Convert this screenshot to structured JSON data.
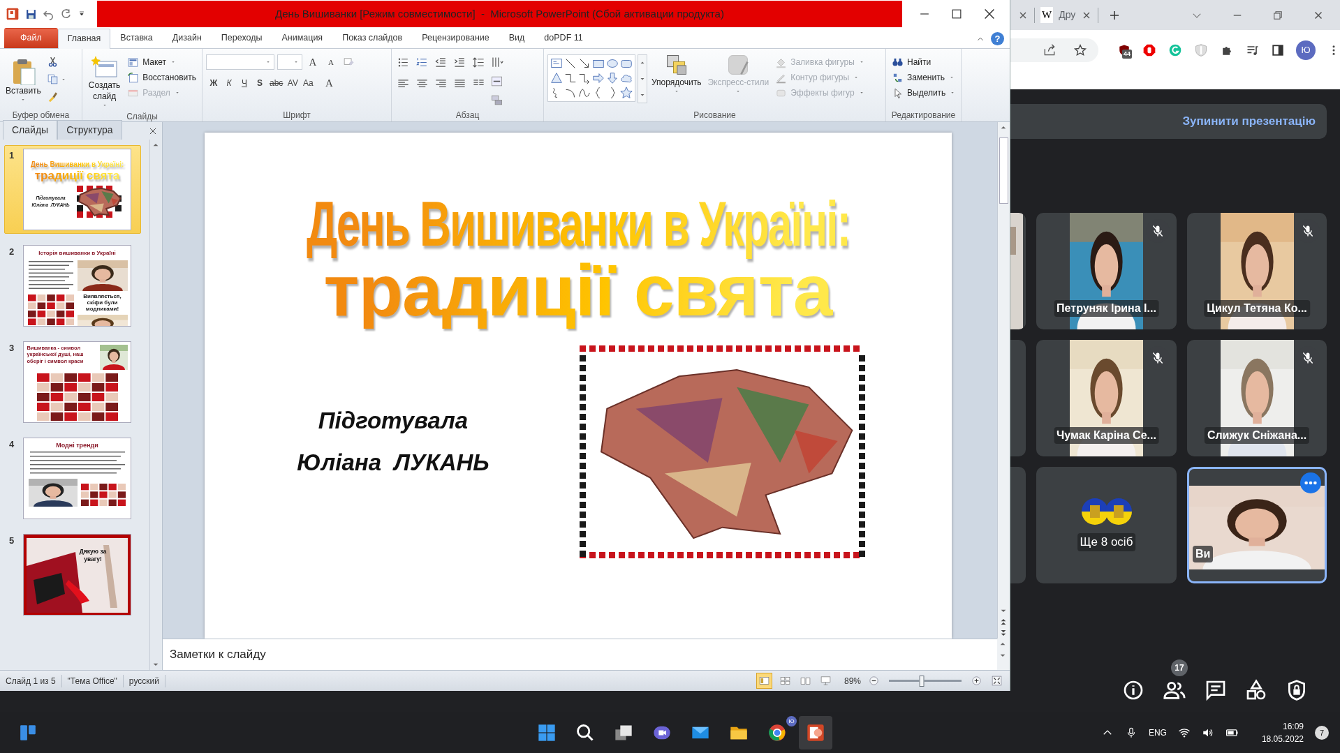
{
  "ppt": {
    "title": "День Вишиванки [Режим совместимости]  -  Microsoft PowerPoint (Сбой активации продукта)",
    "tabs": [
      {
        "label": "Файл",
        "kind": "file",
        "selected": false
      },
      {
        "label": "Главная",
        "kind": "tab",
        "selected": true
      },
      {
        "label": "Вставка",
        "kind": "tab",
        "selected": false
      },
      {
        "label": "Дизайн",
        "kind": "tab",
        "selected": false
      },
      {
        "label": "Переходы",
        "kind": "tab",
        "selected": false
      },
      {
        "label": "Анимация",
        "kind": "tab",
        "selected": false
      },
      {
        "label": "Показ слайдов",
        "kind": "tab",
        "selected": false
      },
      {
        "label": "Рецензирование",
        "kind": "tab",
        "selected": false
      },
      {
        "label": "Вид",
        "kind": "tab",
        "selected": false
      },
      {
        "label": "doPDF 11",
        "kind": "tab",
        "selected": false
      }
    ],
    "help": "?",
    "ribbon": [
      {
        "label": "Буфер обмена",
        "kind": "clipboard",
        "items": [
          {
            "label": "Вставить",
            "kind": "large",
            "disabled": false
          }
        ]
      },
      {
        "label": "Слайды",
        "kind": "slides",
        "items": [
          {
            "label": "Создать слайд",
            "kind": "large",
            "disabled": false
          },
          {
            "label": "Макет",
            "kind": "small",
            "disabled": false
          },
          {
            "label": "Восстановить",
            "kind": "small",
            "disabled": false
          },
          {
            "label": "Раздел",
            "kind": "small",
            "disabled": true
          }
        ]
      },
      {
        "label": "Шрифт",
        "kind": "font",
        "size_buttons": [
          "A",
          "A"
        ],
        "format_buttons": [
          "Ж",
          "К",
          "Ч",
          "S",
          "abc",
          "AV",
          "Aa",
          "A"
        ]
      },
      {
        "label": "Абзац",
        "kind": "paragraph"
      },
      {
        "label": "Рисование",
        "kind": "drawing",
        "items": [
          {
            "label": "Упорядочить",
            "kind": "large",
            "disabled": false
          },
          {
            "label": "Экспресс-стили",
            "kind": "large",
            "disabled": true
          },
          {
            "label": "Заливка фигуры",
            "kind": "small",
            "disabled": true
          },
          {
            "label": "Контур фигуры",
            "kind": "small",
            "disabled": true
          },
          {
            "label": "Эффекты фигур",
            "kind": "small",
            "disabled": true
          }
        ]
      },
      {
        "label": "Редактирование",
        "kind": "editing",
        "items": [
          {
            "label": "Найти",
            "kind": "small",
            "disabled": false
          },
          {
            "label": "Заменить",
            "kind": "small",
            "disabled": false
          },
          {
            "label": "Выделить",
            "kind": "small",
            "disabled": false
          }
        ]
      }
    ],
    "pane_tabs": [
      {
        "label": "Слайды",
        "selected": true
      },
      {
        "label": "Структура",
        "selected": false
      }
    ],
    "slides": [
      {
        "number": "1",
        "selected": true,
        "kind": "title",
        "lines": [
          "День Вишиванки в Україні:",
          "традиції свята",
          "Підготувала",
          "Юліана  ЛУКАНЬ"
        ]
      },
      {
        "number": "2",
        "selected": false,
        "kind": "collage",
        "title": "Історія вишиванки в Україні",
        "caption": "Виявляється, скіфи були модниками!"
      },
      {
        "number": "3",
        "selected": false,
        "kind": "patterns",
        "title": "Вишиванка - символ української душі, наш оберіг і символ краси"
      },
      {
        "number": "4",
        "selected": false,
        "kind": "text",
        "title": "Модні тренди"
      },
      {
        "number": "5",
        "selected": false,
        "kind": "closing",
        "title": "Дякую за увагу!"
      }
    ],
    "slide": {
      "title": "День Вишиванки в Україні:",
      "subtitle": "традиції свята",
      "author_label": "Підготувала",
      "author": "Юліана  ЛУКАНЬ"
    },
    "notes": {
      "placeholder": "Заметки к слайду"
    },
    "status": {
      "slide": "Слайд 1 из 5",
      "theme": "\"Тема Office\"",
      "language": "русский",
      "zoom": "89%",
      "zoom_slider": {
        "level": 0.45
      }
    }
  },
  "chrome": {
    "tab_text": "Дру",
    "favicon": "W",
    "extension_badge": "44",
    "avatar": "Ю"
  },
  "meet": {
    "stop_button": "Зупинити презентацію",
    "tiles": [
      {
        "name": "Петруняк Ірина І...",
        "kind": "video",
        "muted": true,
        "selected": false
      },
      {
        "name": "Цикул Тетяна Ко...",
        "kind": "video",
        "muted": true,
        "selected": false
      },
      {
        "name": "Чумак Каріна Се...",
        "kind": "video",
        "muted": true,
        "selected": false
      },
      {
        "name": "Слижук Сніжана...",
        "kind": "video",
        "muted": true,
        "selected": false
      },
      {
        "name": "Ще 8 осіб",
        "kind": "others",
        "muted": false,
        "selected": false
      },
      {
        "name": "Ви",
        "kind": "self",
        "muted": false,
        "selected": true
      }
    ],
    "people_count": "17"
  },
  "taskbar": {
    "chrome_badge": "Ю",
    "language": "ENG",
    "time": "16:09",
    "date": "18.05.2022",
    "notifications": "7"
  }
}
